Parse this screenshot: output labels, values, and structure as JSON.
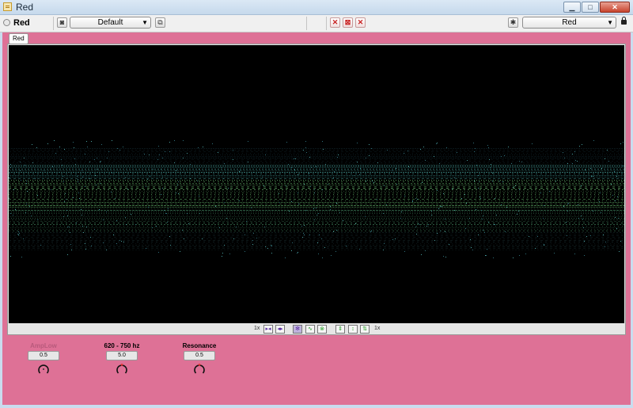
{
  "window": {
    "title": "Red"
  },
  "toolbar": {
    "plugin_name": "Red",
    "preset_select": "Default",
    "right_select": "Red"
  },
  "panel": {
    "tab_label": "Red",
    "zoom": {
      "left_label": "1x",
      "right_label": "1x"
    },
    "knobs": [
      {
        "title": "AmpLow",
        "value": "0.5"
      },
      {
        "title": "620 - 750 hz",
        "value": "5.0"
      },
      {
        "title": "Resonance",
        "value": "0.5"
      }
    ]
  },
  "colors": {
    "panel": "#de7196",
    "viz_bg": "#000000",
    "accent_green": "#1f9a1f",
    "accent_purple": "#5b2ca0"
  }
}
